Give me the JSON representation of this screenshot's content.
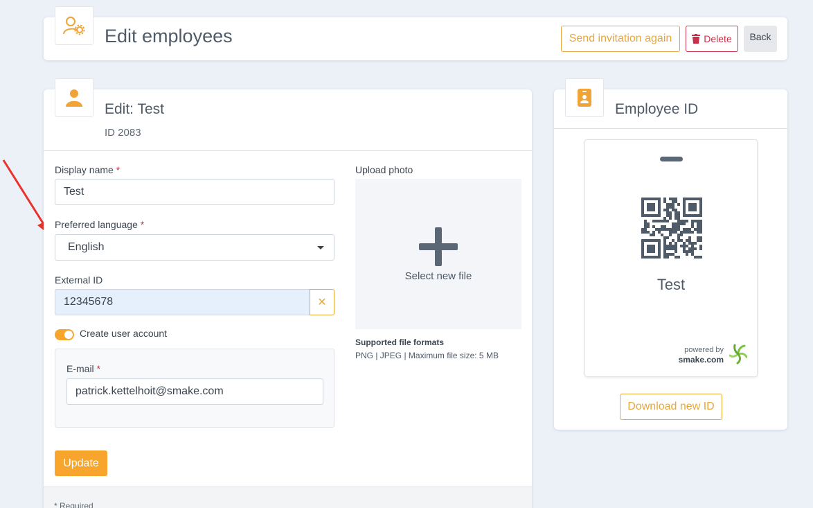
{
  "header": {
    "title": "Edit employees",
    "send_invitation_label": "Send invitation again",
    "delete_label": "Delete",
    "back_label": "Back",
    "icon": "user-cog-icon"
  },
  "edit_card": {
    "title": "Edit: Test",
    "id_text": "ID 2083",
    "icon": "user-icon",
    "display_name": {
      "label": "Display name",
      "required_mark": "*",
      "value": "Test"
    },
    "preferred_language": {
      "label": "Preferred language",
      "required_mark": "*",
      "value": "English"
    },
    "external_id": {
      "label": "External ID",
      "value": "12345678",
      "clear_glyph": "✕"
    },
    "create_user_account": {
      "label": "Create user account",
      "enabled": true
    },
    "email": {
      "label": "E-mail",
      "required_mark": "*",
      "value": "patrick.kettelhoit@smake.com"
    },
    "upload": {
      "label": "Upload photo",
      "select_label": "Select new file",
      "formats_title": "Supported file formats",
      "formats_text": "PNG | JPEG | Maximum file size: 5 MB"
    },
    "update_label": "Update",
    "required_note": "* Required"
  },
  "id_card": {
    "title": "Employee ID",
    "icon": "id-badge-icon",
    "name": "Test",
    "powered_by": "powered by",
    "brand": "smake.com",
    "download_label": "Download new ID"
  },
  "colors": {
    "accent": "#f7a52c",
    "warn_outline": "#e8a73a",
    "danger": "#c9314a",
    "arrow": "#e8322a"
  }
}
